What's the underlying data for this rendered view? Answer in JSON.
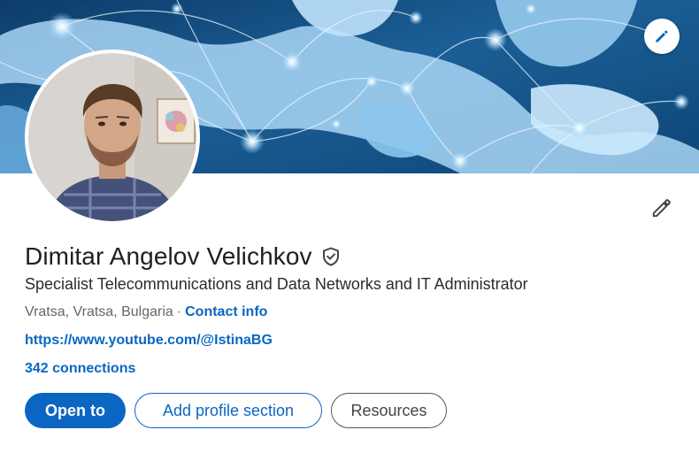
{
  "profile": {
    "name": "Dimitar Angelov Velichkov",
    "headline": "Specialist Telecommunications and Data Networks and IT Administrator",
    "location": "Vratsa, Vratsa, Bulgaria",
    "separator": "·",
    "contact_info_label": "Contact info",
    "website": "https://www.youtube.com/@IstinaBG",
    "connections": "342 connections"
  },
  "actions": {
    "open_to_label": "Open to",
    "add_section_label": "Add profile section",
    "resources_label": "Resources"
  },
  "icons": {
    "banner_edit": "pencil-icon",
    "intro_edit": "pencil-icon",
    "verified": "shield-check-icon"
  },
  "colors": {
    "brand_blue": "#0a66c2",
    "text_primary": "#1f1f1f",
    "text_secondary": "#666666"
  }
}
